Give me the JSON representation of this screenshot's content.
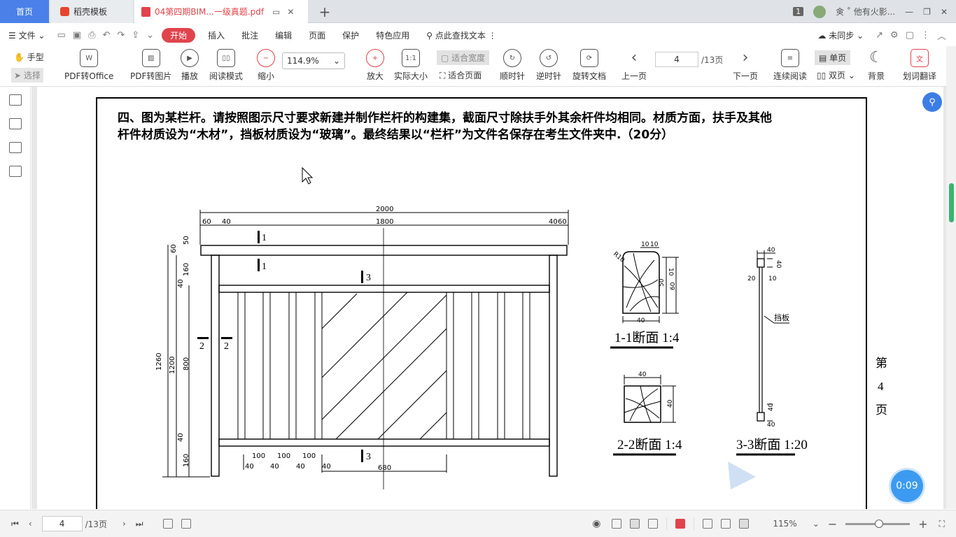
{
  "tabs": {
    "home": "首页",
    "template": "稻壳模板",
    "pdf_title": "04第四期BIM...一级真题.pdf",
    "add": "+"
  },
  "titlebar": {
    "count_badge": "1",
    "user_text": "㑒 ˚ 他有火影...",
    "min": "—",
    "restore": "❐",
    "close": "✕"
  },
  "menu": {
    "file": "文件",
    "start": "开始",
    "insert": "插入",
    "annotate": "批注",
    "edit": "编辑",
    "page": "页面",
    "protect": "保护",
    "feature": "特色应用",
    "search_placeholder": "点此查找文本",
    "sync": "未同步"
  },
  "toolbar": {
    "hand": "手型",
    "select": "选择",
    "pdf2office": "PDF转Office",
    "pdf2img": "PDF转图片",
    "play": "播放",
    "reading": "阅读模式",
    "zoom_out": "缩小",
    "zoom_value": "114.9%",
    "zoom_in": "放大",
    "actual_size": "实际大小",
    "fit_width": "适合宽度",
    "fit_page": "适合页面",
    "rotate_cw": "顺时针",
    "rotate_ccw": "逆时针",
    "rotate_doc": "旋转文档",
    "prev_page": "上一页",
    "page_current": "4",
    "page_total": "/13页",
    "next_page": "下一页",
    "continuous": "连续阅读",
    "single": "单页",
    "double": "双页",
    "background": "背景",
    "translate": "划词翻译"
  },
  "document": {
    "question_line1": "四、图为某栏杆。请按照图示尺寸要求新建并制作栏杆的构建集，截面尺寸除扶手外其余杆件均相同。材质方面，扶手及其他",
    "question_line2": "杆件材质设为“木材”，挡板材质设为“玻璃”。最终结果以“栏杆”为文件名保存在考生文件夹中.（20分）",
    "page_label_1": "第",
    "page_label_2": "4",
    "page_label_3": "页",
    "dims": {
      "d2000": "2000",
      "d1800": "1800",
      "d60a": "60",
      "d40a": "40",
      "d40b": "40",
      "d60b": "60",
      "v60": "60",
      "v50": "50",
      "v160a": "160",
      "v40a": "40",
      "v1260": "1260",
      "v1200": "1200",
      "v800": "800",
      "v40b": "40",
      "v160b": "160",
      "b100a": "100",
      "b100b": "100",
      "b100c": "100",
      "b40a": "40",
      "b40b": "40",
      "b40c": "40",
      "b40d": "40",
      "b680": "680"
    },
    "cuts": {
      "c1a": "1",
      "c1b": "1",
      "c3a": "3",
      "c3b": "3",
      "c2a": "2",
      "c2b": "2"
    },
    "sec1": {
      "r10": "R10",
      "d10a": "10",
      "d10b": "10",
      "d40": "40",
      "d10c": "10",
      "d50": "50",
      "d60": "60",
      "title": "1-1断面 1:4"
    },
    "sec2": {
      "d40a": "40",
      "d40b": "40",
      "title": "2-2断面 1:4"
    },
    "sec3": {
      "d40a": "40",
      "d40b": "40",
      "d20": "20",
      "d10": "10",
      "label": "挡板",
      "d40c": "40",
      "d40d": "40",
      "title": "3-3断面 1:20"
    }
  },
  "status": {
    "page_current": "4",
    "page_total": "/13页",
    "zoom": "115%",
    "timer": "0:09"
  }
}
